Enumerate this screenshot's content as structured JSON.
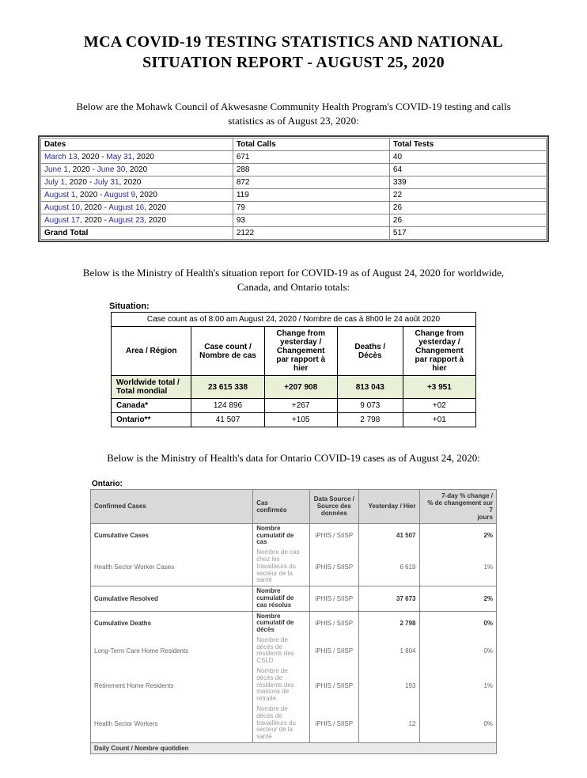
{
  "title_l1": "MCA COVID-19 TESTING STATISTICS AND NATIONAL",
  "title_l2": "SITUATION REPORT - AUGUST 25, 2020",
  "intro1_l1": "Below are the Mohawk Council of Akwesasne Community Health Program's COVID-19 testing and calls",
  "intro1_l2": "statistics as of August 23, 2020:",
  "table1": {
    "h1": "Dates",
    "h2": "Total Calls",
    "h3": "Total Tests",
    "rows": [
      {
        "d1a": "March 13",
        "d1m": ", 2020 - ",
        "d1b": "May 31",
        "d1s": ", 2020",
        "calls": "671",
        "tests": "40"
      },
      {
        "d1a": "June 1",
        "d1m": ", 2020 - ",
        "d1b": "June 30",
        "d1s": ", 2020",
        "calls": "288",
        "tests": "64"
      },
      {
        "d1a": "July 1",
        "d1m": ", 2020 - ",
        "d1b": "July 31",
        "d1s": ", 2020",
        "calls": "872",
        "tests": "339"
      },
      {
        "d1a": "August 1",
        "d1m": ", 2020 - ",
        "d1b": "August 9",
        "d1s": ", 2020",
        "calls": "119",
        "tests": "22"
      },
      {
        "d1a": "August 10",
        "d1m": ", 2020 - ",
        "d1b": "August 16",
        "d1s": ", 2020",
        "calls": "79",
        "tests": "26"
      },
      {
        "d1a": "August 17",
        "d1m": ", 2020 - ",
        "d1b": "August 23",
        "d1s": ", 2020",
        "calls": "93",
        "tests": "26"
      }
    ],
    "gt_label": "Grand Total",
    "gt_calls": "2122",
    "gt_tests": "517"
  },
  "intro2_l1": "Below is the Ministry of Health's situation report for COVID-19 as of August 24, 2020 for worldwide,",
  "intro2_l2": "Canada, and Ontario totals:",
  "sec2label": "Situation:",
  "table2": {
    "caption": "Case count as of 8:00 am August 24, 2020 / Nombre de cas à 8h00 le 24 août 2020",
    "h_area": "Area / Région",
    "h_count_l1": "Case count /",
    "h_count_l2": "Nombre de cas",
    "h_chg_l1": "Change from",
    "h_chg_l2": "yesterday /",
    "h_chg_l3": "Changement",
    "h_chg_l4": "par rapport à",
    "h_chg_l5": "hier",
    "h_deaths_l1": "Deaths /",
    "h_deaths_l2": "Décès",
    "h_dchg_l1": "Change from",
    "h_dchg_l2": "yesterday /",
    "h_dchg_l3": "Changement",
    "h_dchg_l4": "par rapport à",
    "h_dchg_l5": "hier",
    "world_l1": "Worldwide total /",
    "world_l2": "Total mondial",
    "world_count": "23 615 338",
    "world_chg": "+207 908",
    "world_deaths": "813 043",
    "world_dchg": "+3 951",
    "canada_label": "Canada*",
    "canada_count": "124 896",
    "canada_chg": "+267",
    "canada_deaths": "9 073",
    "canada_dchg": "+02",
    "ontario_label": "Ontario**",
    "ontario_count": "41 507",
    "ontario_chg": "+105",
    "ontario_deaths": "2 798",
    "ontario_dchg": "+01"
  },
  "intro3": "Below is the Ministry of Health's data for Ontario COVID-19 cases as of August 24, 2020:",
  "sec3label": "Ontario:",
  "table3": {
    "h_confirmed": "Confirmed Cases",
    "h_cas_l1": "Cas",
    "h_cas_l2": "confirmés",
    "h_src_l1": "Data Source /",
    "h_src_l2": "Source des",
    "h_src_l3": "données",
    "h_yest": "Yesterday / Hier",
    "h_7d_l1": "7-day % change /",
    "h_7d_l2": "% de changement sur 7",
    "h_7d_l3": "jours",
    "r1_label": "Cumulative Cases",
    "r1_cas_l1": "Nombre",
    "r1_cas_l2": "cumulatif de",
    "r1_cas_l3": "cas",
    "r1_src": "iPHIS / SIISP",
    "r1_yest": "41 507",
    "r1_7d": "2%",
    "r2_label": "Health Sector Worker Cases",
    "r2_cas_l1": "Nombre de cas",
    "r2_cas_l2": "chez les",
    "r2_cas_l3": "travailleurs du",
    "r2_cas_l4": "secteur de la",
    "r2_cas_l5": "santé",
    "r2_src": "iPHIS / SIISP",
    "r2_yest": "6 619",
    "r2_7d": "1%",
    "r3_label": "Cumulative Resolved",
    "r3_cas_l1": "Nombre",
    "r3_cas_l2": "cumulatif de",
    "r3_cas_l3": "cas résolus",
    "r3_src": "iPHIS / SIISP",
    "r3_yest": "37 673",
    "r3_7d": "2%",
    "r4_label": "Cumulative Deaths",
    "r4_cas_l1": "Nombre",
    "r4_cas_l2": "cumulatif de",
    "r4_cas_l3": "décès",
    "r4_src": "iPHIS / SIISP",
    "r4_yest": "2 798",
    "r4_7d": "0%",
    "r5_label": "Long-Term Care Home Residents",
    "r5_cas_l1": "Nombre de",
    "r5_cas_l2": "décès de",
    "r5_cas_l3": "résidents des",
    "r5_cas_l4": "CSLD",
    "r5_src": "iPHIS / SIISP",
    "r5_yest": "1 804",
    "r5_7d": "0%",
    "r6_label": "Retirement Home Residents",
    "r6_cas_l1": "Nombre de",
    "r6_cas_l2": "décès de",
    "r6_cas_l3": "résidents des",
    "r6_cas_l4": "maisons de",
    "r6_cas_l5": "retraite",
    "r6_src": "iPHIS / SIISP",
    "r6_yest": "193",
    "r6_7d": "1%",
    "r7_label": "Health Sector Workers",
    "r7_cas_l1": "Nombre de",
    "r7_cas_l2": "décès de",
    "r7_cas_l3": "travailleurs du",
    "r7_cas_l4": "secteur de la",
    "r7_cas_l5": "santé",
    "r7_src": "iPHIS / SIISP",
    "r7_yest": "12",
    "r7_7d": "0%",
    "footer": "Daily Count / Nombre quotidien"
  }
}
